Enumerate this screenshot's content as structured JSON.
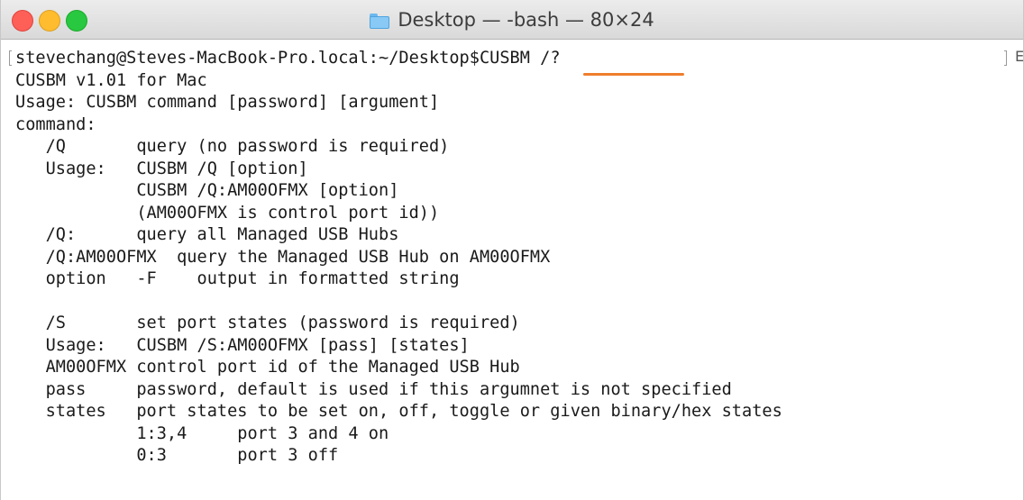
{
  "window": {
    "title": "Desktop — -bash — 80×24"
  },
  "terminal": {
    "prompt": "stevechang@Steves-MacBook-Pro.local:~/Desktop$",
    "command": "CUSBM /?",
    "lines": [
      "CUSBM v1.01 for Mac",
      "Usage: CUSBM command [password] [argument]",
      "command:",
      "   /Q       query (no password is required)",
      "   Usage:   CUSBM /Q [option]",
      "            CUSBM /Q:AM00OFMX [option]",
      "            (AM00OFMX is control port id))",
      "   /Q:      query all Managed USB Hubs",
      "   /Q:AM00OFMX  query the Managed USB Hub on AM00OFMX",
      "   option   -F    output in formatted string",
      "",
      "   /S       set port states (password is required)",
      "   Usage:   CUSBM /S:AM00OFMX [pass] [states]",
      "   AM00OFMX control port id of the Managed USB Hub",
      "   pass     password, default is used if this argumnet is not specified",
      "   states   port states to be set on, off, toggle or given binary/hex states",
      "            1:3,4     port 3 and 4 on",
      "            0:3       port 3 off"
    ]
  },
  "icons": {
    "title_icon": "folder-icon",
    "edge_icon": "E"
  },
  "colors": {
    "underline": "#ef7d2c",
    "close": "#fe5f57",
    "minimize": "#febc2e",
    "zoom": "#28c840"
  }
}
